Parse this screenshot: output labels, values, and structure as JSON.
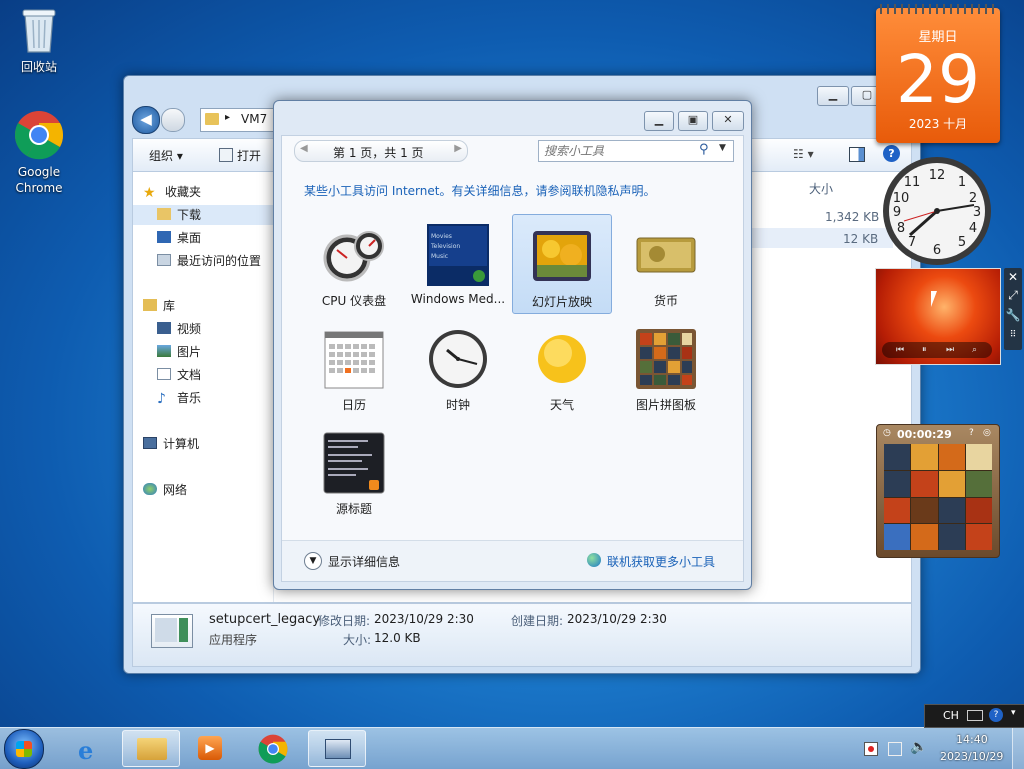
{
  "desktop": {
    "icons": [
      {
        "label": "回收站",
        "icon": "recycle-bin-icon"
      },
      {
        "label": "Google Chrome",
        "icon": "chrome-icon"
      }
    ]
  },
  "explorer": {
    "address": "VM7",
    "toolbar": {
      "organize": "组织 ▾",
      "open": "打开"
    },
    "nav": {
      "favorites": "收藏夹",
      "downloads": "下载",
      "desktop": "桌面",
      "recent": "最近访问的位置",
      "library": "库",
      "videos": "视频",
      "pictures": "图片",
      "documents": "文档",
      "music": "音乐",
      "computer": "计算机",
      "network": "网络"
    },
    "column_size": "大小",
    "sizes": [
      "1,342 KB",
      "12 KB"
    ],
    "status": {
      "file_name": "setupcert_legacy",
      "file_type": "应用程序",
      "modified_label": "修改日期:",
      "modified_value": "2023/10/29 2:30",
      "created_label": "创建日期:",
      "created_value": "2023/10/29 2:30",
      "size_label": "大小:",
      "size_value": "12.0 KB"
    }
  },
  "gadget_dialog": {
    "page_info": "第 1 页，共 1 页",
    "search_placeholder": "搜索小工具",
    "notice": "某些小工具访问 Internet。有关详细信息，请参阅联机隐私声明。",
    "gadgets": [
      {
        "label": "CPU 仪表盘",
        "icon": "cpu-meter-icon"
      },
      {
        "label": "Windows Med...",
        "icon": "media-center-icon"
      },
      {
        "label": "幻灯片放映",
        "icon": "slideshow-icon",
        "selected": true
      },
      {
        "label": "货币",
        "icon": "currency-icon"
      },
      {
        "label": "日历",
        "icon": "calendar-icon"
      },
      {
        "label": "时钟",
        "icon": "clock-icon"
      },
      {
        "label": "天气",
        "icon": "weather-icon"
      },
      {
        "label": "图片拼图板",
        "icon": "puzzle-icon"
      },
      {
        "label": "源标题",
        "icon": "feed-headlines-icon"
      }
    ],
    "show_details": "显示详细信息",
    "get_more": "联机获取更多小工具"
  },
  "desktop_gadgets": {
    "calendar": {
      "weekday": "星期日",
      "day": "29",
      "month_year": "2023 十月"
    },
    "puzzle_timer": "00:00:29"
  },
  "taskbar": {
    "ime": "CH",
    "time": "14:40",
    "date": "2023/10/29"
  },
  "colors": {
    "accent_link": "#1a62b8",
    "calendar_orange": "#f07020"
  }
}
